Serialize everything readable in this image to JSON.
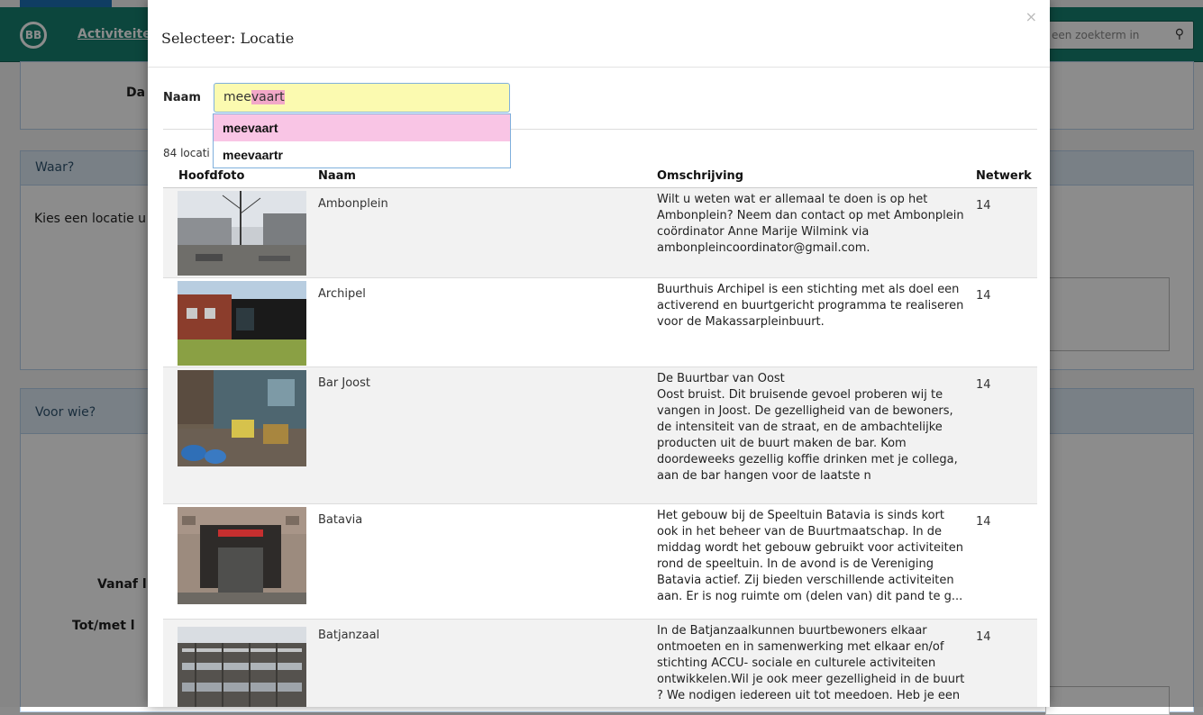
{
  "background": {
    "nav_link": "Activiteiten",
    "logo_text": "BB",
    "search_placeholder": "een zoekterm in",
    "label_date": "Da",
    "panel_waar": "Waar?",
    "text_kies": "Kies een locatie u",
    "panel_voor_wie": "Voor wie?",
    "label_vanaf": "Vanaf l",
    "label_totmet": "Tot/met l"
  },
  "modal": {
    "title": "Selecteer: Locatie",
    "close_symbol": "×",
    "naam_label": "Naam",
    "search_value_prefix": "mee",
    "search_value_highlight": "vaart",
    "suggestions": [
      "meevaart",
      "meevaartr"
    ],
    "count_text": "84 locati",
    "columns": [
      "Hoofdfoto",
      "Naam",
      "Omschrijving",
      "Netwerk"
    ],
    "rows": [
      {
        "naam": "Ambonplein",
        "desc": [
          "Wilt u weten wat er allemaal te doen is op het",
          "Ambonplein? Neem dan contact op met Ambonplein",
          "coördinator Anne Marije Wilmink via",
          "ambonpleincoordinator@gmail.com."
        ],
        "netwerk": "14"
      },
      {
        "naam": "Archipel",
        "desc": [
          "Buurthuis Archipel is een stichting met als doel een",
          "activerend en buurtgericht programma te realiseren",
          "voor de Makassarpleinbuurt."
        ],
        "netwerk": "14"
      },
      {
        "naam": "Bar Joost",
        "desc": [
          "De Buurtbar van Oost",
          "Oost bruist. Dit bruisende gevoel proberen wij te",
          "vangen in Joost. De gezelligheid van de bewoners,",
          "de intensiteit van de straat, en de ambachtelijke",
          "producten uit de buurt maken de bar. Kom",
          "doordeweeks gezellig koffie drinken met je collega,",
          "aan de bar hangen voor de laatste n"
        ],
        "netwerk": "14"
      },
      {
        "naam": "Batavia",
        "desc": [
          "Het gebouw bij de Speeltuin Batavia is sinds kort",
          "ook in het beheer van de Buurtmaatschap. In de",
          "middag wordt het gebouw gebruikt voor activiteiten",
          "rond de speeltuin. In de avond is de Vereniging",
          "Batavia actief. Zij bieden verschillende activiteiten",
          "aan. Er is nog ruimte om (delen van) dit pand te g..."
        ],
        "netwerk": "14"
      },
      {
        "naam": "Batjanzaal",
        "desc": [
          "In de Batjanzaalkunnen buurtbewoners elkaar",
          "ontmoeten en in samenwerking met elkaar en/of",
          "stichting ACCU- sociale en culturele activiteiten",
          "ontwikkelen.Wil je ook meer gezelligheid in de buurt",
          "? We nodigen iedereen uit tot meedoen. Heb je een"
        ],
        "netwerk": "14"
      }
    ]
  }
}
